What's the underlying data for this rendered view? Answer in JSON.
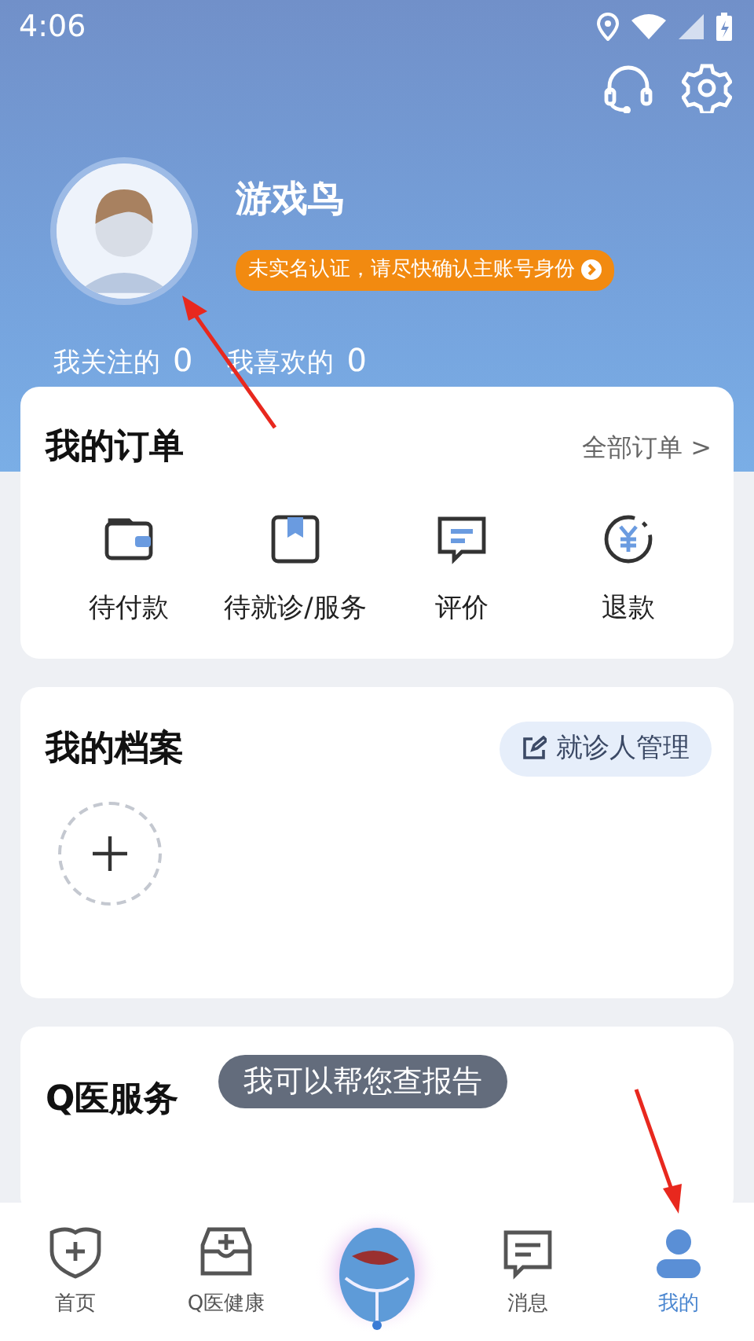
{
  "status_bar": {
    "time": "4:06"
  },
  "profile": {
    "name": "游戏鸟",
    "verify_notice": "未实名认证，请尽快确认主账号身份",
    "stats": [
      {
        "label": "我关注的",
        "value": "0"
      },
      {
        "label": "我喜欢的",
        "value": "0"
      }
    ]
  },
  "orders": {
    "title": "我的订单",
    "link": "全部订单 >",
    "items": [
      {
        "kind": "wallet",
        "label": "待付款"
      },
      {
        "kind": "bookmark",
        "label": "待就诊/服务"
      },
      {
        "kind": "comment",
        "label": "评价"
      },
      {
        "kind": "refund",
        "label": "退款"
      }
    ]
  },
  "records": {
    "title": "我的档案",
    "button": "就诊人管理"
  },
  "services": {
    "title": "Q医服务",
    "tooltip": "我可以帮您查报告"
  },
  "tab_bar": [
    {
      "kind": "home",
      "label": "首页",
      "selected": false
    },
    {
      "kind": "health",
      "label": "Q医健康",
      "selected": false
    },
    {
      "kind": "assistant",
      "selected": false
    },
    {
      "kind": "messages",
      "label": "消息",
      "selected": false
    },
    {
      "kind": "profile",
      "label": "我的",
      "selected": true
    }
  ]
}
